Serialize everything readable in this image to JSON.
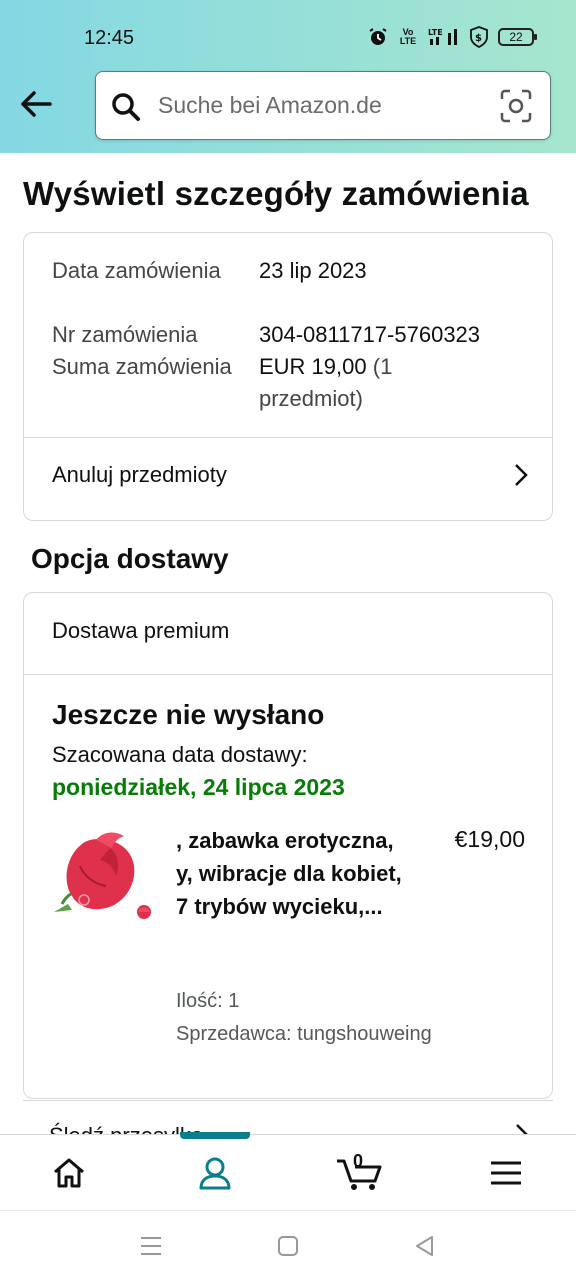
{
  "status_bar": {
    "time": "12:45",
    "volte": "Vo LTE",
    "signal": "LTE",
    "battery": "22"
  },
  "search": {
    "placeholder": "Suche bei Amazon.de"
  },
  "page": {
    "title": "Wyświetl szczegóły zamówienia"
  },
  "order_summary": {
    "date_label": "Data zamówienia",
    "date_value": "23 lip 2023",
    "number_label": "Nr zamówienia",
    "number_value": "304-0811717-5760323",
    "total_label": "Suma zamówienia",
    "total_value": "EUR 19,00",
    "total_count": "(1 przedmiot)",
    "cancel_label": "Anuluj przedmioty"
  },
  "delivery": {
    "section_title": "Opcja dostawy",
    "type": "Dostawa premium",
    "status": "Jeszcze nie wysłano",
    "estimate_label": "Szacowana data dostawy:",
    "estimate_date": "poniedziałek, 24 lipca 2023",
    "estimate_color": "#067d06"
  },
  "product": {
    "title": ", zabawka erotyczna, y, wibracje dla kobiet, 7 trybów wycieku,...",
    "price": "€19,00",
    "quantity": "Ilość: 1",
    "seller": "Sprzedawca: tungshouweing",
    "image_icon": "rose-product-image"
  },
  "peek": {
    "text": "Śledź przesyłkę"
  },
  "bottom_nav": {
    "items": [
      "home-icon",
      "account-icon",
      "cart-icon",
      "menu-icon"
    ],
    "cart_count": "0",
    "active": "account-icon",
    "accent": "#0a7e8c"
  },
  "theme": {
    "header_gradient_start": "#84d8e3",
    "header_gradient_end": "#a6e6ce"
  }
}
